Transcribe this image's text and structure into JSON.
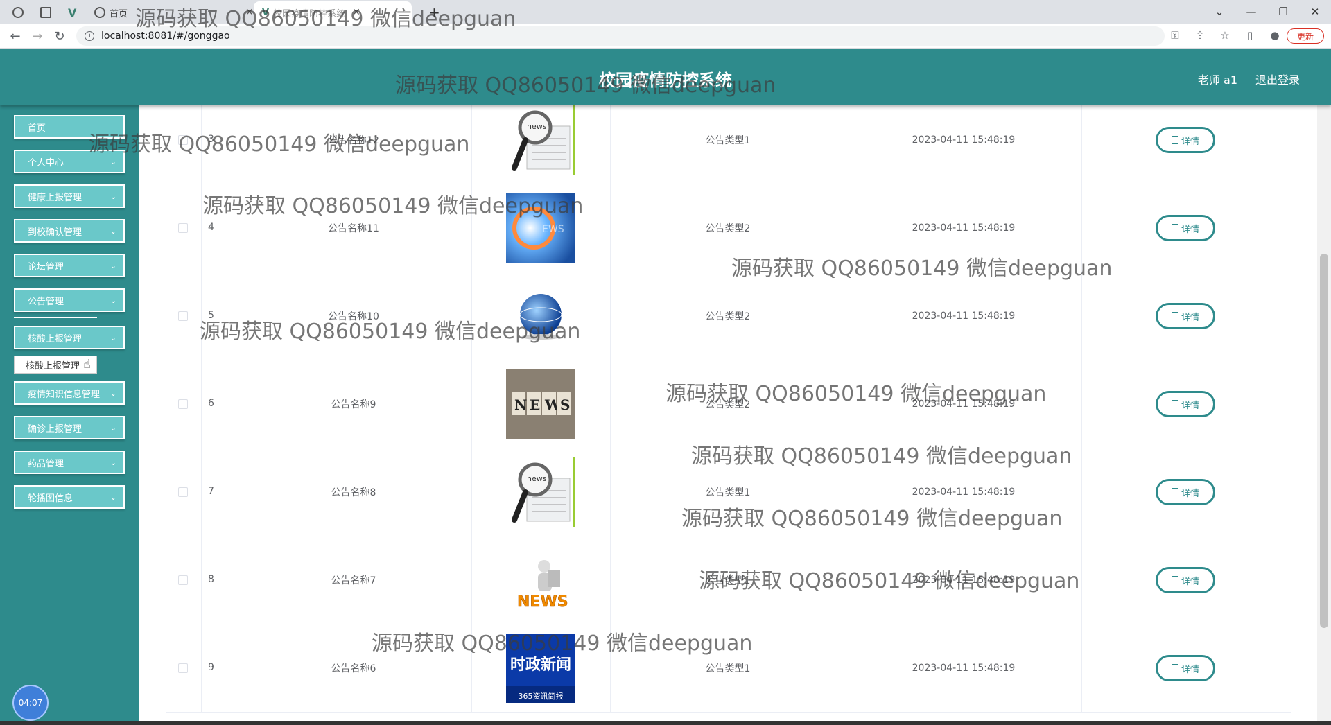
{
  "browser": {
    "tabs": [
      {
        "label": "首页"
      },
      {
        "label": "校园疫情防控系统"
      }
    ],
    "url": "localhost:8081/#/gonggao",
    "update_label": "更新",
    "new_tab": "+"
  },
  "header": {
    "title": "校园疫情防控系统",
    "user": "老师 a1",
    "logout": "退出登录"
  },
  "sidebar": {
    "items": [
      {
        "label": "首页",
        "chevron": false
      },
      {
        "label": "个人中心",
        "chevron": true
      },
      {
        "label": "健康上报管理",
        "chevron": true
      },
      {
        "label": "到校确认管理",
        "chevron": true
      },
      {
        "label": "论坛管理",
        "chevron": true
      },
      {
        "label": "公告管理",
        "chevron": true
      },
      {
        "label": "核酸上报管理",
        "chevron": true
      },
      {
        "label": "疫情知识信息管理",
        "chevron": true
      },
      {
        "label": "确诊上报管理",
        "chevron": true
      },
      {
        "label": "药品管理",
        "chevron": true
      },
      {
        "label": "轮播图信息",
        "chevron": true
      }
    ],
    "tooltip": "核酸上报管理",
    "clock": "04:07"
  },
  "table": {
    "rows": [
      {
        "index": "3",
        "name": "公告名称12",
        "image": "news-magnifier",
        "type": "公告类型1",
        "time": "2023-04-11 15:48:19",
        "action": "详情"
      },
      {
        "index": "4",
        "name": "公告名称11",
        "image": "news-blue-abstract",
        "type": "公告类型2",
        "time": "2023-04-11 15:48:19",
        "action": "详情"
      },
      {
        "index": "5",
        "name": "公告名称10",
        "image": "news-globe",
        "type": "公告类型2",
        "time": "2023-04-11 15:48:19",
        "action": "详情"
      },
      {
        "index": "6",
        "name": "公告名称9",
        "image": "news-letter-blocks",
        "type": "公告类型2",
        "time": "2023-04-11 15:48:19",
        "action": "详情"
      },
      {
        "index": "7",
        "name": "公告名称8",
        "image": "news-magnifier",
        "type": "公告类型1",
        "time": "2023-04-11 15:48:19",
        "action": "详情"
      },
      {
        "index": "8",
        "name": "公告名称7",
        "image": "news-3d-man",
        "type": "公告类型1",
        "time": "2023-04-11 15:48:19",
        "action": "详情"
      },
      {
        "index": "9",
        "name": "公告名称6",
        "image": "news-tv-banner",
        "type": "公告类型1",
        "time": "2023-04-11 15:48:19",
        "action": "详情"
      }
    ],
    "image_texts": {
      "news3d": "NEWS",
      "tv_title": "时政新闻",
      "tv_sub": "365资讯简报"
    }
  },
  "watermark": "源码获取 QQ86050149 微信deepguan"
}
